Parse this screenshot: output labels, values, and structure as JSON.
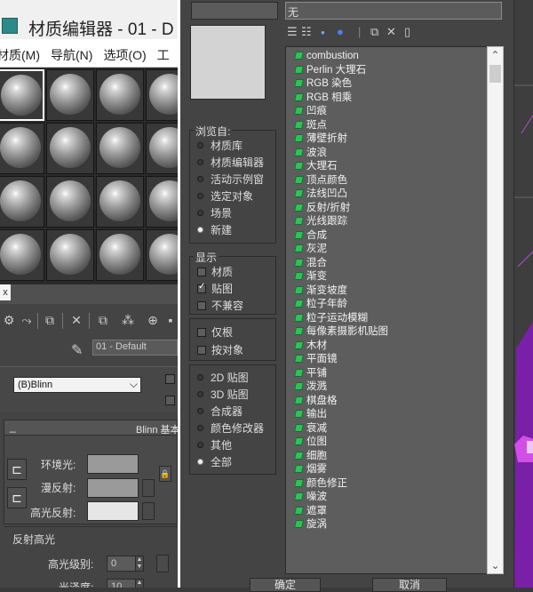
{
  "material_editor": {
    "title": "材质编辑器 - 01 - D",
    "menu": [
      "材质(M)",
      "导航(N)",
      "选项(O)",
      "工"
    ],
    "current_material": "01 - Default",
    "shader": "(B)Blinn",
    "blinn_rollout_title": "Blinn 基本",
    "ambient_label": "环境光:",
    "diffuse_label": "漫反射:",
    "specular_label": "高光反射:",
    "specular_highlights_title": "反射高光",
    "specular_level_label": "高光级别:",
    "specular_level_value": "0",
    "glossiness_label": "光泽度:",
    "glossiness_value": "10",
    "close_glyph": "x",
    "colors": {
      "ambient": "#9a9a9a",
      "diffuse": "#9a9a9a",
      "specular": "#e6e6e6"
    }
  },
  "browser": {
    "name_field_value": "无",
    "browse_from": {
      "title": "浏览自:",
      "options": [
        "材质库",
        "材质编辑器",
        "活动示例窗",
        "选定对象",
        "场景",
        "新建"
      ],
      "selected_index": 5
    },
    "show": {
      "title": "显示",
      "items": [
        {
          "label": "材质",
          "checked": false
        },
        {
          "label": "贴图",
          "checked": true
        },
        {
          "label": "不兼容",
          "checked": false
        }
      ]
    },
    "filters": [
      {
        "label": "仅根",
        "checked": false
      },
      {
        "label": "按对象",
        "checked": false
      }
    ],
    "map_types": {
      "options": [
        "2D 贴图",
        "3D 贴图",
        "合成器",
        "颜色修改器",
        "其他",
        "全部"
      ],
      "selected_index": 5
    },
    "maps": [
      "combustion",
      "Perlin 大理石",
      "RGB 染色",
      "RGB 相乘",
      "凹痕",
      "斑点",
      "薄壁折射",
      "波浪",
      "大理石",
      "顶点颜色",
      "法线凹凸",
      "反射/折射",
      "光线跟踪",
      "合成",
      "灰泥",
      "混合",
      "渐变",
      "渐变坡度",
      "粒子年龄",
      "粒子运动模糊",
      "每像素摄影机贴图",
      "木材",
      "平面镜",
      "平铺",
      "泼溅",
      "棋盘格",
      "输出",
      "衰减",
      "位图",
      "细胞",
      "烟雾",
      "颜色修正",
      "噪波",
      "遮罩",
      "旋涡"
    ],
    "ok_label": "确定",
    "cancel_label": "取消"
  }
}
